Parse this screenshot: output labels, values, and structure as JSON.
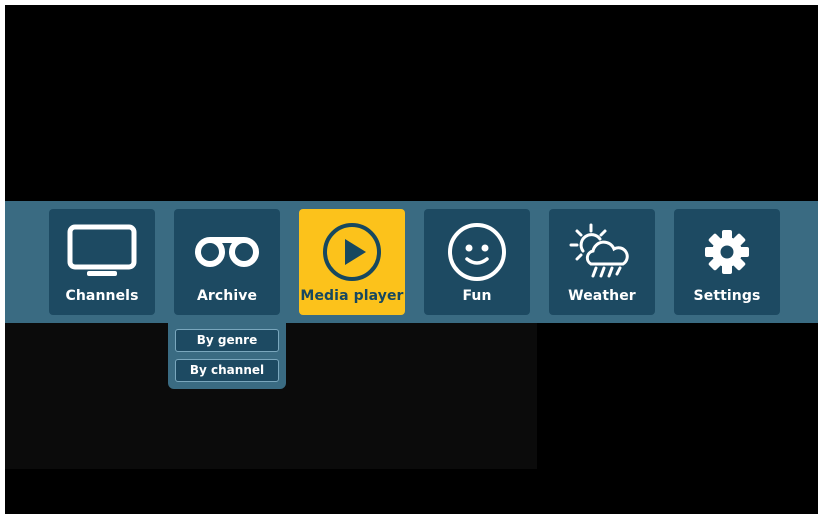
{
  "menu": {
    "items": [
      {
        "label": "Channels",
        "icon": "tv-icon",
        "active": false
      },
      {
        "label": "Archive",
        "icon": "cassette-icon",
        "active": false
      },
      {
        "label": "Media player",
        "icon": "play-icon",
        "active": true
      },
      {
        "label": "Fun",
        "icon": "smiley-icon",
        "active": false
      },
      {
        "label": "Weather",
        "icon": "weather-icon",
        "active": false
      },
      {
        "label": "Settings",
        "icon": "gear-icon",
        "active": false
      }
    ]
  },
  "archive_submenu": {
    "items": [
      {
        "label": "By genre"
      },
      {
        "label": "By channel"
      }
    ]
  },
  "colors": {
    "bar": "#3a6b82",
    "tile": "#1d4a62",
    "active_tile": "#fcc21b",
    "active_text": "#17485f"
  }
}
